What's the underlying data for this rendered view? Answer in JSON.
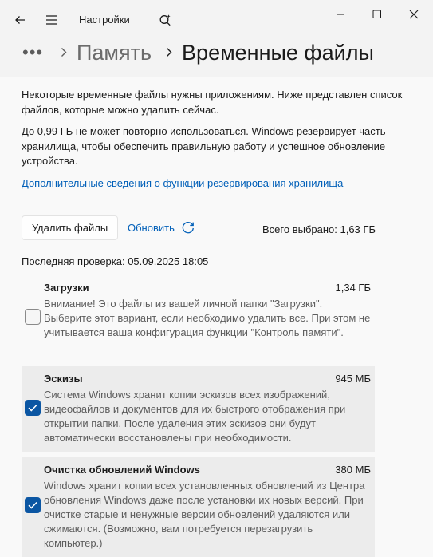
{
  "window": {
    "app_title": "Настройки"
  },
  "breadcrumb": {
    "dots": "•••",
    "parent": "Память",
    "current": "Временные файлы"
  },
  "content": {
    "intro": "Некоторые временные файлы нужны приложениям. Ниже представлен список файлов, которые можно удалить сейчас.",
    "reserve_note": "До 0,99 ГБ не может повторно использоваться. Windows резервирует часть хранилища, чтобы обеспечить правильную работу и успешное обновление устройства.",
    "reserve_link": "Дополнительные сведения о функции резервирования хранилища",
    "delete_button": "Удалить файлы",
    "refresh_label": "Обновить",
    "total_selected": "Всего выбрано: 1,63 ГБ",
    "last_check": "Последняя проверка: 05.09.2025 18:05"
  },
  "items": [
    {
      "title": "Загрузки",
      "size": "1,34 ГБ",
      "checked": false,
      "description": "Внимание! Это файлы из вашей личной папки \"Загрузки\". Выберите этот вариант, если необходимо удалить все. При этом не учитывается ваша конфигурация функции \"Контроль памяти\"."
    },
    {
      "title": "Эскизы",
      "size": "945 МБ",
      "checked": true,
      "description": "Система Windows хранит копии эскизов всех изображений, видеофайлов и документов для их быстрого отображения при открытии папки. После удаления этих эскизов они будут автоматически восстановлены при необходимости."
    },
    {
      "title": "Очистка обновлений Windows",
      "size": "380 МБ",
      "checked": true,
      "description": "Windows хранит копии всех установленных обновлений из Центра обновления Windows даже после установки их новых версий. При очистке старые и ненужные версии обновлений удаляются или сжимаются. (Возможно, вам потребуется перезагрузить компьютер.)"
    }
  ],
  "colors": {
    "accent": "#005fb8",
    "checkbox_checked": "#0b56a3",
    "window_bg": "#f3f3f3",
    "content_bg": "#f9f9f9"
  }
}
